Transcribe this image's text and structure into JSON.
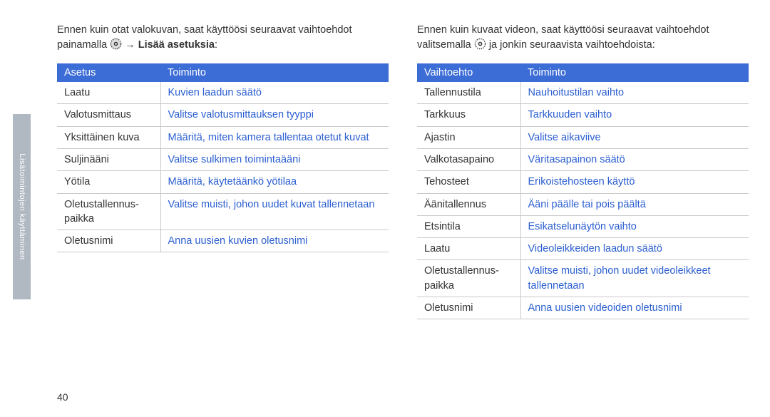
{
  "side_tab": "Lisätoimintojen käyttäminen",
  "page_number": "40",
  "arrow": "→",
  "col_left": {
    "intro_a": "Ennen kuin otat valokuvan, saat käyttöösi seuraavat vaihtoehdot painamalla ",
    "intro_b": " → ",
    "intro_c_bold": "Lisää asetuksia",
    "intro_d": ":",
    "header1": "Asetus",
    "header2": "Toiminto",
    "rows": [
      {
        "a": "Laatu",
        "b": "Kuvien laadun säätö"
      },
      {
        "a": "Valotusmittaus",
        "b": "Valitse valotusmittauksen tyyppi"
      },
      {
        "a": "Yksittäinen kuva",
        "b": "Määritä, miten kamera tallentaa otetut kuvat"
      },
      {
        "a": "Suljinääni",
        "b": "Valitse sulkimen toimintaääni"
      },
      {
        "a": "Yötila",
        "b": "Määritä, käytetäänkö yötilaa"
      },
      {
        "a": "Oletustallennus-paikka",
        "b": "Valitse muisti, johon uudet kuvat tallennetaan"
      },
      {
        "a": "Oletusnimi",
        "b": "Anna uusien kuvien oletusnimi"
      }
    ]
  },
  "col_right": {
    "intro_a": "Ennen kuin kuvaat videon, saat käyttöösi seuraavat vaihtoehdot valitsemalla ",
    "intro_b": " ja jonkin seuraavista vaihtoehdoista:",
    "header1": "Vaihtoehto",
    "header2": "Toiminto",
    "rows": [
      {
        "a": "Tallennustila",
        "b": "Nauhoitustilan vaihto"
      },
      {
        "a": "Tarkkuus",
        "b": "Tarkkuuden vaihto"
      },
      {
        "a": "Ajastin",
        "b": "Valitse aikaviive"
      },
      {
        "a": "Valkotasapaino",
        "b": "Väritasapainon säätö"
      },
      {
        "a": "Tehosteet",
        "b": "Erikoistehosteen käyttö"
      },
      {
        "a": "Äänitallennus",
        "b": "Ääni päälle tai pois päältä"
      },
      {
        "a": "Etsintila",
        "b": "Esikatselunäytön vaihto"
      },
      {
        "a": "Laatu",
        "b": "Videoleikkeiden laadun säätö"
      },
      {
        "a": "Oletustallennus-paikka",
        "b": "Valitse muisti, johon uudet videoleikkeet tallennetaan"
      },
      {
        "a": "Oletusnimi",
        "b": "Anna uusien videoiden oletusnimi"
      }
    ]
  }
}
